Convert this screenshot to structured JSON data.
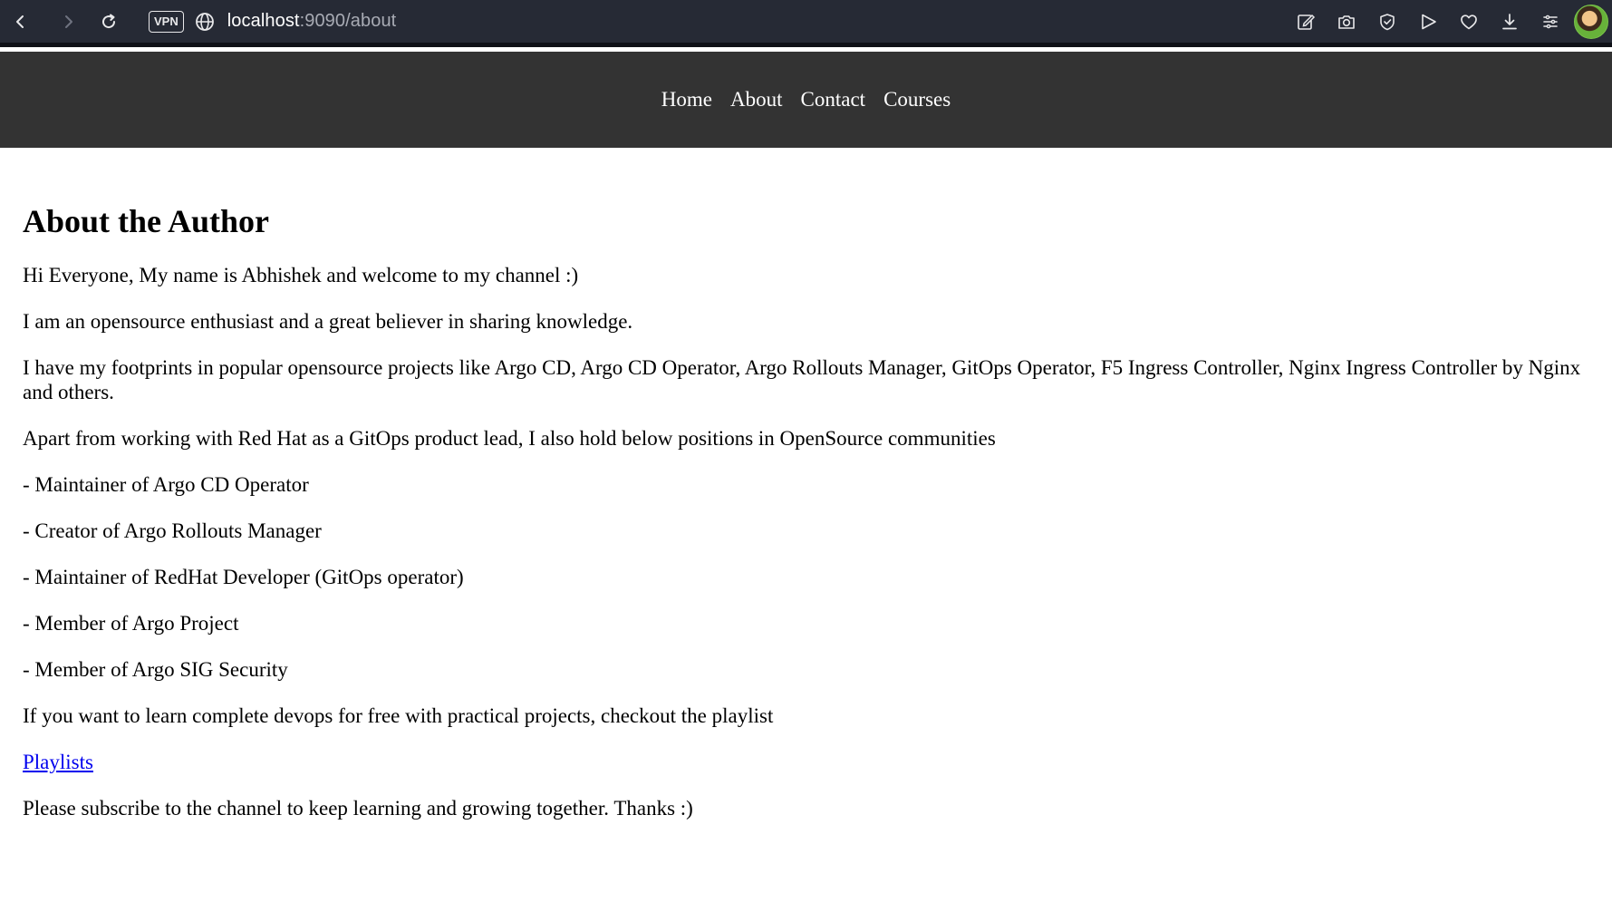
{
  "browser": {
    "vpn_label": "VPN",
    "url_host": "localhost",
    "url_path": ":9090/about"
  },
  "nav": {
    "links": [
      "Home",
      "About",
      "Contact",
      "Courses"
    ]
  },
  "main": {
    "heading": "About the Author",
    "paragraphs": [
      "Hi Everyone, My name is Abhishek and welcome to my channel :)",
      "I am an opensource enthusiast and a great believer in sharing knowledge.",
      "I have my footprints in popular opensource projects like Argo CD, Argo CD Operator, Argo Rollouts Manager, GitOps Operator, F5 Ingress Controller, Nginx Ingress Controller by Nginx and others.",
      "Apart from working with Red Hat as a GitOps product lead, I also hold below positions in OpenSource communities",
      "- Maintainer of Argo CD Operator",
      "- Creator of Argo Rollouts Manager",
      "- Maintainer of RedHat Developer (GitOps operator)",
      "- Member of Argo Project",
      "- Member of Argo SIG Security",
      "If you want to learn complete devops for free with practical projects, checkout the playlist"
    ],
    "playlist_link": "Playlists",
    "closing": "Please subscribe to the channel to keep learning and growing together. Thanks :)"
  }
}
